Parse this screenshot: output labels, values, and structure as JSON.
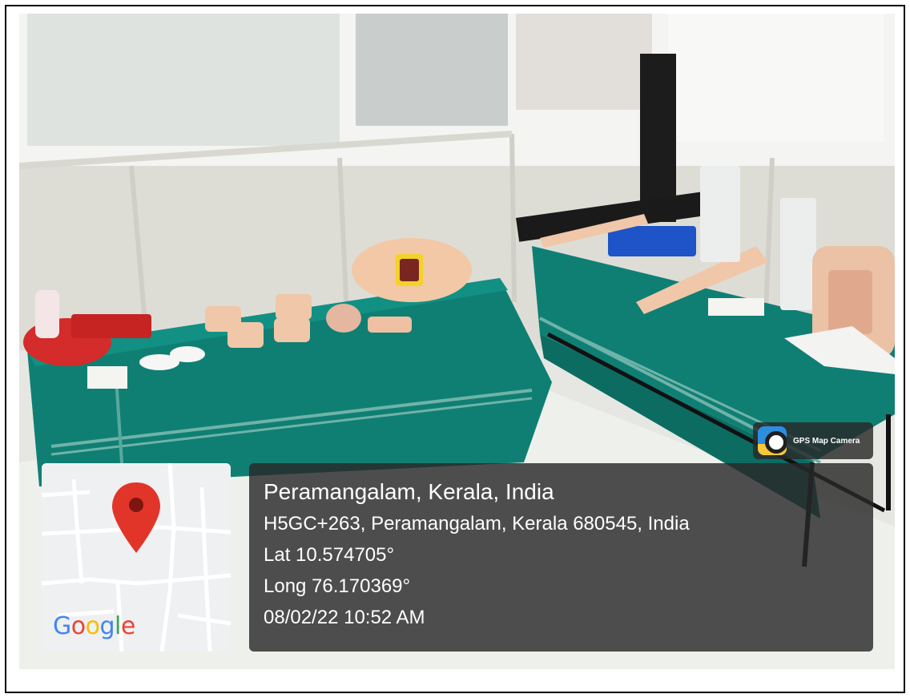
{
  "location": {
    "title": "Peramangalam, Kerala, India",
    "address": "H5GC+263, Peramangalam, Kerala 680545, India",
    "latitude": "Lat 10.574705°",
    "longitude": "Long 76.170369°",
    "datetime": "08/02/22 10:52 AM"
  },
  "map": {
    "logo_text": [
      "G",
      "o",
      "o",
      "g",
      "l",
      "e"
    ],
    "pin_icon": "map-pin-icon",
    "pin_color": "#e2352a"
  },
  "badge": {
    "label": "GPS Map Camera",
    "icon": "gps-map-camera-icon"
  },
  "colors": {
    "overlay": "#282828",
    "tablecloth": "#0f7f74"
  }
}
